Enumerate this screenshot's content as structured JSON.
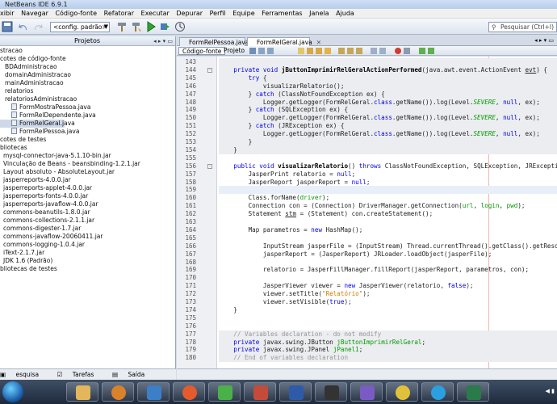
{
  "window": {
    "title": "NetBeans IDE 6.9.1"
  },
  "menu": [
    "xibir",
    "Navegar",
    "Código-fonte",
    "Refatorar",
    "Executar",
    "Depurar",
    "Perfil",
    "Equipe",
    "Ferramentas",
    "Janela",
    "Ajuda"
  ],
  "toolbar": {
    "config_value": "<config. padrão>",
    "search_placeholder": "Pesquisar (Ctrl+I)"
  },
  "projects_panel": {
    "title": "Projetos"
  },
  "tree": [
    {
      "label": "stracao"
    },
    {
      "label": "cotes de código-fonte"
    },
    {
      "label": "BDAdministracao"
    },
    {
      "label": "domainAdministracao"
    },
    {
      "label": "mainAdministracao"
    },
    {
      "label": "relatorios"
    },
    {
      "label": "relatoriosAdministracao"
    },
    {
      "label": "FormMostraPessoa.java",
      "file": true
    },
    {
      "label": "FormRelDependente.java",
      "file": true
    },
    {
      "label": "FormRelGeral.java",
      "file": true,
      "selected": true
    },
    {
      "label": "FormRelPessoa.java",
      "file": true
    },
    {
      "label": "cotes de testes"
    },
    {
      "label": "bliotecas"
    },
    {
      "label": "mysql-connector-java-5.1.10-bin.jar"
    },
    {
      "label": "Vinculação de Beans - beansbinding-1.2.1.jar"
    },
    {
      "label": "Layout absoluto - AbsoluteLayout.jar"
    },
    {
      "label": "jasperreports-4.0.0.jar"
    },
    {
      "label": "jasperreports-applet-4.0.0.jar"
    },
    {
      "label": "jasperreports-fonts-4.0.0.jar"
    },
    {
      "label": "jasperreports-javaflow-4.0.0.jar"
    },
    {
      "label": "commons-beanutils-1.8.0.jar"
    },
    {
      "label": "commons-collections-2.1.1.jar"
    },
    {
      "label": "commons-digester-1.7.jar"
    },
    {
      "label": "commons-javaflow-20060411.jar"
    },
    {
      "label": "commons-logging-1.0.4.jar"
    },
    {
      "label": "iText-2.1.7.jar"
    },
    {
      "label": "JDK 1.6 (Padrão)"
    },
    {
      "label": "bliotecas de testes"
    }
  ],
  "bottom_tabs": [
    "esquisa",
    "Tarefas",
    "Saída"
  ],
  "editor_tabs": [
    {
      "label": "FormRelPessoa.java",
      "active": false
    },
    {
      "label": "FormRelGeral.java",
      "active": true
    }
  ],
  "view_buttons": {
    "source": "Código-fonte",
    "design": "Projeto"
  },
  "code": [
    {
      "n": "143",
      "h": ""
    },
    {
      "n": "144",
      "fold": "-",
      "h": "    <span class=\"kw\">private void</span> <span class=\"mt\">jButtonImprimirRelGeralActionPerformed</span>(java.awt.event.ActionEvent <span class=\"ul\">evt</span>) {"
    },
    {
      "n": "145",
      "h": "        <span class=\"kw\">try</span> {"
    },
    {
      "n": "146",
      "h": "            visualizarRelatorio();"
    },
    {
      "n": "147",
      "h": "        } <span class=\"kw\">catch</span> (ClassNotFoundException ex) {"
    },
    {
      "n": "148",
      "h": "            Logger.getLogger(FormRelGeral.<span class=\"kw\">class</span>.getName()).log(Level.<span class=\"st\">SEVERE</span>, <span class=\"kw\">null</span>, ex);"
    },
    {
      "n": "149",
      "h": "        } <span class=\"kw\">catch</span> (SQLException ex) {"
    },
    {
      "n": "150",
      "h": "            Logger.getLogger(FormRelGeral.<span class=\"kw\">class</span>.getName()).log(Level.<span class=\"st\">SEVERE</span>, <span class=\"kw\">null</span>, ex);"
    },
    {
      "n": "151",
      "h": "        } <span class=\"kw\">catch</span> (JRException ex) {"
    },
    {
      "n": "152",
      "h": "            Logger.getLogger(FormRelGeral.<span class=\"kw\">class</span>.getName()).log(Level.<span class=\"st\">SEVERE</span>, <span class=\"kw\">null</span>, ex);"
    },
    {
      "n": "153",
      "h": "        }"
    },
    {
      "n": "154",
      "h": "    }"
    },
    {
      "n": "155",
      "h": ""
    },
    {
      "n": "156",
      "fold": "-",
      "h": "    <span class=\"kw\">public void</span> <span class=\"mt\">visualizarRelatorio</span>() <span class=\"kw\">throws</span> ClassNotFoundException, SQLException, JRException {"
    },
    {
      "n": "157",
      "h": "        JasperPrint relatorio = <span class=\"kw\">null</span>;"
    },
    {
      "n": "158",
      "h": "        JasperReport jasperReport = <span class=\"kw\">null</span>;"
    },
    {
      "n": "159",
      "h": ""
    },
    {
      "n": "160",
      "h": "        Class.forName(<span class=\"fld\">driver</span>);"
    },
    {
      "n": "161",
      "h": "        Connection con = (Connection) DriverManager.getConnection(<span class=\"fld\">url</span>, <span class=\"fld\">login</span>, <span class=\"fld\">pwd</span>);"
    },
    {
      "n": "162",
      "h": "        Statement <span class=\"ul\">stm</span> = (Statement) con.createStatement();"
    },
    {
      "n": "163",
      "h": ""
    },
    {
      "n": "164",
      "h": "        Map parametros = <span class=\"kw\">new</span> HashMap();"
    },
    {
      "n": "165",
      "h": ""
    },
    {
      "n": "166",
      "h": "            InputStream jasperFile = (InputStream) Thread.currentThread().getClass().getResourceAs"
    },
    {
      "n": "167",
      "h": "            jasperReport = (JasperReport) JRLoader.loadObject(jasperFile);"
    },
    {
      "n": "168",
      "h": ""
    },
    {
      "n": "169",
      "h": "            relatorio = JasperFillManager.fillReport(jasperReport, parametros, con);"
    },
    {
      "n": "170",
      "h": ""
    },
    {
      "n": "171",
      "h": "            JasperViewer viewer = <span class=\"kw\">new</span> JasperViewer(relatorio, <span class=\"kw\">false</span>);"
    },
    {
      "n": "172",
      "h": "            viewer.setTitle(<span class=\"str\">\"Relatório\"</span>);"
    },
    {
      "n": "173",
      "h": "            viewer.setVisible(<span class=\"kw\">true</span>);"
    },
    {
      "n": "174",
      "h": "    }"
    },
    {
      "n": "175",
      "h": ""
    },
    {
      "n": "176",
      "h": ""
    },
    {
      "n": "177",
      "h": "    <span class=\"cm\">// Variables declaration - do not modify</span>"
    },
    {
      "n": "178",
      "h": "    <span class=\"kw\">private</span> javax.swing.JButton <span class=\"fld\">jButtonImprimirRelGeral</span>;"
    },
    {
      "n": "179",
      "h": "    <span class=\"kw\">private</span> javax.swing.JPanel <span class=\"fld\">jPanel1</span>;"
    },
    {
      "n": "180",
      "h": "    <span class=\"cm\">// End of variables declaration</span>"
    }
  ]
}
